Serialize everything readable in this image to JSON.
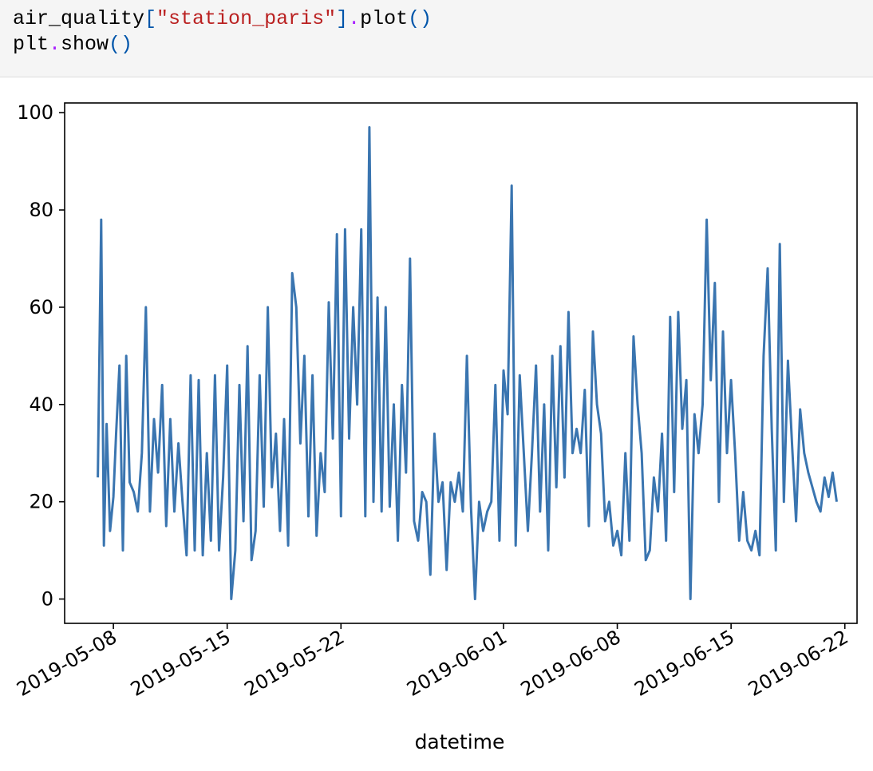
{
  "code_cell": {
    "line1": {
      "obj": "air_quality",
      "open_bracket": "[",
      "key": "\"station_paris\"",
      "close_bracket": "]",
      "dot": ".",
      "method": "plot",
      "parens": "()"
    },
    "line2": {
      "obj": "plt",
      "dot": ".",
      "method": "show",
      "parens": "()"
    }
  },
  "chart_data": {
    "type": "line",
    "title": "",
    "xlabel": "datetime",
    "ylabel": "",
    "ylim": [
      -5,
      102
    ],
    "xlim": [
      "2019-05-05",
      "2019-06-22 18:00"
    ],
    "x_ticks": [
      "2019-05-08",
      "2019-05-15",
      "2019-05-22",
      "2019-06-01",
      "2019-06-08",
      "2019-06-15",
      "2019-06-22"
    ],
    "y_ticks": [
      0,
      20,
      40,
      60,
      80,
      100
    ],
    "grid": false,
    "legend": "none",
    "line_color": "#3a75b0",
    "series": [
      {
        "x": [
          "2019-05-07 01:00",
          "2019-05-07 06:00",
          "2019-05-07 10:00",
          "2019-05-07 14:00",
          "2019-05-07 19:00",
          "2019-05-08 00:00",
          "2019-05-08 04:00",
          "2019-05-08 09:00",
          "2019-05-08 14:00",
          "2019-05-08 19:00",
          "2019-05-09 00:00",
          "2019-05-09 06:00",
          "2019-05-09 12:00",
          "2019-05-09 18:00",
          "2019-05-10 00:00",
          "2019-05-10 06:00",
          "2019-05-10 12:00",
          "2019-05-10 18:00",
          "2019-05-11 00:00",
          "2019-05-11 06:00",
          "2019-05-11 12:00",
          "2019-05-11 18:00",
          "2019-05-12 00:00",
          "2019-05-12 06:00",
          "2019-05-12 12:00",
          "2019-05-12 18:00",
          "2019-05-13 00:00",
          "2019-05-13 06:00",
          "2019-05-13 12:00",
          "2019-05-13 18:00",
          "2019-05-14 00:00",
          "2019-05-14 06:00",
          "2019-05-14 12:00",
          "2019-05-14 18:00",
          "2019-05-15 00:00",
          "2019-05-15 06:00",
          "2019-05-15 12:00",
          "2019-05-15 18:00",
          "2019-05-16 00:00",
          "2019-05-16 06:00",
          "2019-05-16 12:00",
          "2019-05-16 18:00",
          "2019-05-17 00:00",
          "2019-05-17 06:00",
          "2019-05-17 12:00",
          "2019-05-17 18:00",
          "2019-05-18 00:00",
          "2019-05-18 06:00",
          "2019-05-18 12:00",
          "2019-05-18 18:00",
          "2019-05-19 00:00",
          "2019-05-19 06:00",
          "2019-05-19 12:00",
          "2019-05-19 18:00",
          "2019-05-20 00:00",
          "2019-05-20 06:00",
          "2019-05-20 12:00",
          "2019-05-20 18:00",
          "2019-05-21 00:00",
          "2019-05-21 06:00",
          "2019-05-21 12:00",
          "2019-05-21 18:00",
          "2019-05-22 00:00",
          "2019-05-22 06:00",
          "2019-05-22 12:00",
          "2019-05-22 18:00",
          "2019-05-23 00:00",
          "2019-05-23 06:00",
          "2019-05-23 12:00",
          "2019-05-23 18:00",
          "2019-05-24 00:00",
          "2019-05-24 06:00",
          "2019-05-24 12:00",
          "2019-05-24 18:00",
          "2019-05-25 00:00",
          "2019-05-25 06:00",
          "2019-05-25 12:00",
          "2019-05-25 18:00",
          "2019-05-26 00:00",
          "2019-05-26 06:00",
          "2019-05-26 12:00",
          "2019-05-26 18:00",
          "2019-05-27 00:00",
          "2019-05-27 06:00",
          "2019-05-27 12:00",
          "2019-05-27 18:00",
          "2019-05-28 00:00",
          "2019-05-28 06:00",
          "2019-05-28 12:00",
          "2019-05-28 18:00",
          "2019-05-29 00:00",
          "2019-05-29 06:00",
          "2019-05-29 12:00",
          "2019-05-29 18:00",
          "2019-05-30 00:00",
          "2019-05-30 06:00",
          "2019-05-30 12:00",
          "2019-05-30 18:00",
          "2019-05-31 00:00",
          "2019-05-31 06:00",
          "2019-05-31 12:00",
          "2019-05-31 18:00",
          "2019-06-01 00:00",
          "2019-06-01 06:00",
          "2019-06-01 12:00",
          "2019-06-01 18:00",
          "2019-06-02 00:00",
          "2019-06-02 06:00",
          "2019-06-02 12:00",
          "2019-06-02 18:00",
          "2019-06-03 00:00",
          "2019-06-03 06:00",
          "2019-06-03 12:00",
          "2019-06-03 18:00",
          "2019-06-04 00:00",
          "2019-06-04 06:00",
          "2019-06-04 12:00",
          "2019-06-04 18:00",
          "2019-06-05 00:00",
          "2019-06-05 06:00",
          "2019-06-05 12:00",
          "2019-06-05 18:00",
          "2019-06-06 00:00",
          "2019-06-06 06:00",
          "2019-06-06 12:00",
          "2019-06-06 18:00",
          "2019-06-07 00:00",
          "2019-06-07 06:00",
          "2019-06-07 12:00",
          "2019-06-07 18:00",
          "2019-06-08 00:00",
          "2019-06-08 06:00",
          "2019-06-08 12:00",
          "2019-06-08 18:00",
          "2019-06-09 00:00",
          "2019-06-09 06:00",
          "2019-06-09 12:00",
          "2019-06-09 18:00",
          "2019-06-10 00:00",
          "2019-06-10 06:00",
          "2019-06-10 12:00",
          "2019-06-10 18:00",
          "2019-06-11 00:00",
          "2019-06-11 06:00",
          "2019-06-11 12:00",
          "2019-06-11 18:00",
          "2019-06-12 00:00",
          "2019-06-12 06:00",
          "2019-06-12 12:00",
          "2019-06-12 18:00",
          "2019-06-13 00:00",
          "2019-06-13 06:00",
          "2019-06-13 12:00",
          "2019-06-13 18:00",
          "2019-06-14 00:00",
          "2019-06-14 06:00",
          "2019-06-14 12:00",
          "2019-06-14 18:00",
          "2019-06-15 00:00",
          "2019-06-15 06:00",
          "2019-06-15 12:00",
          "2019-06-15 18:00",
          "2019-06-16 00:00",
          "2019-06-16 06:00",
          "2019-06-16 12:00",
          "2019-06-16 18:00",
          "2019-06-17 00:00",
          "2019-06-17 06:00",
          "2019-06-17 12:00",
          "2019-06-17 18:00",
          "2019-06-18 00:00",
          "2019-06-18 06:00",
          "2019-06-18 12:00",
          "2019-06-18 18:00",
          "2019-06-19 00:00",
          "2019-06-19 06:00",
          "2019-06-19 12:00",
          "2019-06-19 18:00",
          "2019-06-20 00:00",
          "2019-06-20 06:00",
          "2019-06-20 12:00",
          "2019-06-20 18:00",
          "2019-06-21 00:00",
          "2019-06-21 06:00",
          "2019-06-21 12:00"
        ],
        "y": [
          25,
          78,
          11,
          36,
          14,
          21,
          34,
          48,
          10,
          50,
          24,
          22,
          18,
          30,
          60,
          18,
          37,
          26,
          44,
          15,
          37,
          18,
          32,
          20,
          9,
          46,
          10,
          45,
          9,
          30,
          12,
          46,
          10,
          25,
          48,
          0,
          10,
          44,
          16,
          52,
          8,
          14,
          46,
          19,
          60,
          23,
          34,
          14,
          37,
          11,
          67,
          60,
          32,
          50,
          17,
          46,
          13,
          30,
          22,
          61,
          33,
          75,
          17,
          76,
          33,
          60,
          40,
          76,
          17,
          97,
          20,
          62,
          18,
          60,
          19,
          40,
          12,
          44,
          26,
          70,
          16,
          12,
          22,
          20,
          5,
          34,
          20,
          24,
          6,
          24,
          20,
          26,
          18,
          50,
          19,
          0,
          20,
          14,
          18,
          20,
          44,
          12,
          47,
          38,
          85,
          11,
          46,
          30,
          14,
          30,
          48,
          18,
          40,
          10,
          50,
          23,
          52,
          25,
          59,
          30,
          35,
          30,
          43,
          15,
          55,
          40,
          34,
          16,
          20,
          11,
          14,
          9,
          30,
          12,
          54,
          40,
          30,
          8,
          10,
          25,
          18,
          34,
          12,
          58,
          22,
          59,
          35,
          45,
          0,
          38,
          30,
          40,
          78,
          45,
          65,
          20,
          55,
          30,
          45,
          30,
          12,
          22,
          12,
          10,
          14,
          9,
          50,
          68,
          35,
          10,
          73,
          20,
          49,
          32,
          16,
          39,
          30,
          26,
          23,
          20,
          18,
          25,
          21,
          26,
          20
        ]
      }
    ]
  }
}
